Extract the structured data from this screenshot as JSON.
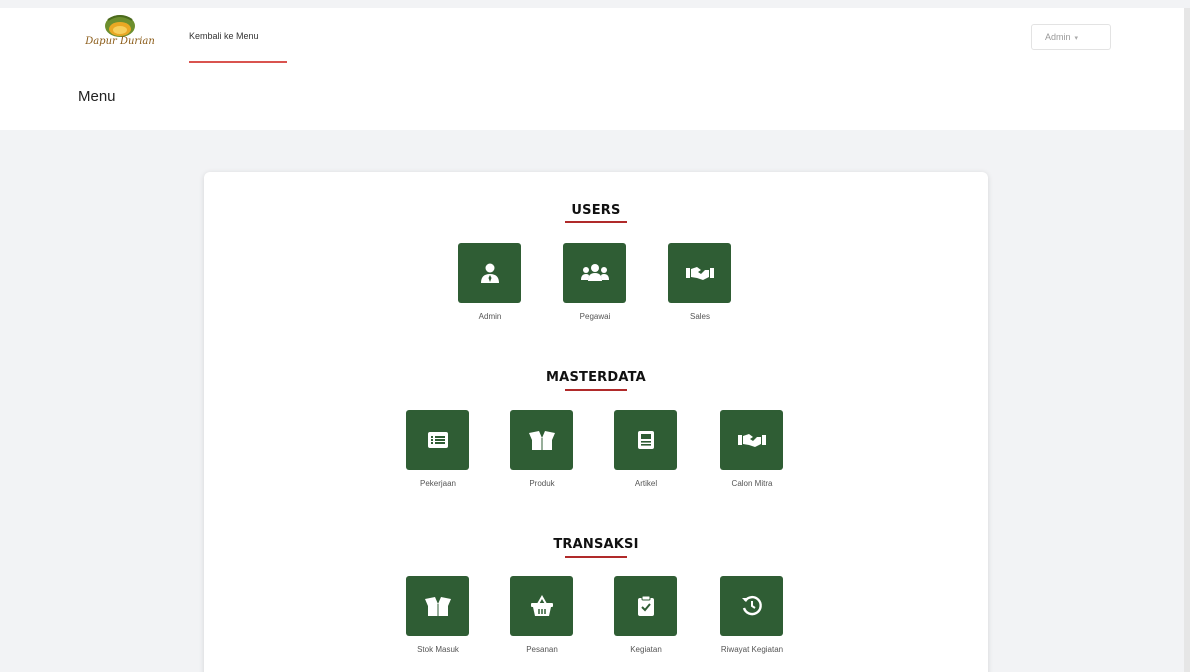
{
  "brand": {
    "logo_text": "Dapur Durian"
  },
  "nav": {
    "back_to_menu": "Kembali ke Menu"
  },
  "user_menu": {
    "label": "Admin",
    "caret": "▾"
  },
  "page": {
    "title": "Menu"
  },
  "colors": {
    "tile_bg": "#2f5d34",
    "accent": "#d9534f",
    "section_underline": "#b02a2a"
  },
  "sections": {
    "users": {
      "title": "USERS",
      "items": [
        {
          "label": "Admin",
          "icon": "user-tie-icon"
        },
        {
          "label": "Pegawai",
          "icon": "users-group-icon"
        },
        {
          "label": "Sales",
          "icon": "handshake-icon"
        }
      ]
    },
    "masterdata": {
      "title": "MASTERDATA",
      "items": [
        {
          "label": "Pekerjaan",
          "icon": "list-card-icon"
        },
        {
          "label": "Produk",
          "icon": "box-open-icon"
        },
        {
          "label": "Artikel",
          "icon": "newspaper-icon"
        },
        {
          "label": "Calon Mitra",
          "icon": "handshake-icon"
        }
      ]
    },
    "transaksi": {
      "title": "TRANSAKSI",
      "items": [
        {
          "label": "Stok Masuk",
          "icon": "box-open-icon"
        },
        {
          "label": "Pesanan",
          "icon": "basket-icon"
        },
        {
          "label": "Kegiatan",
          "icon": "clipboard-check-icon"
        },
        {
          "label": "Riwayat Kegiatan",
          "icon": "history-icon"
        }
      ]
    }
  }
}
